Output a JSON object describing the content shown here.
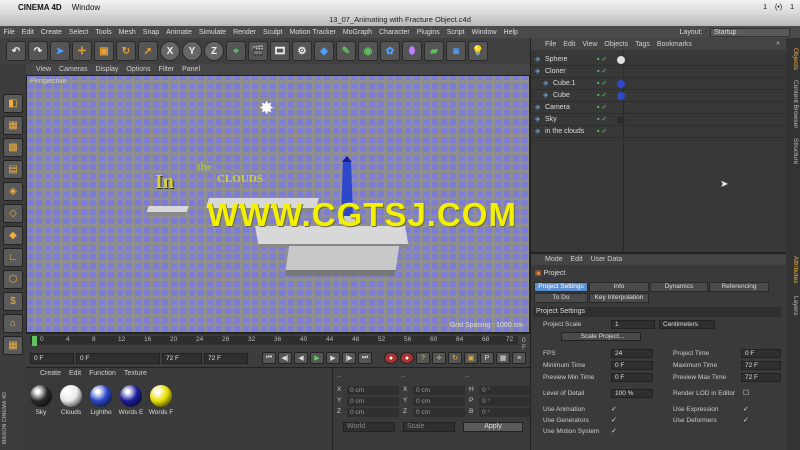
{
  "mac_menubar": {
    "app_name": "CINEMA 4D",
    "menu": "Window",
    "status": [
      "1",
      "(•)",
      "1"
    ]
  },
  "window_title": "13_07_Animating with Fracture Object.c4d",
  "app_menu": [
    "File",
    "Edit",
    "Create",
    "Select",
    "Tools",
    "Mesh",
    "Snap",
    "Animate",
    "Simulate",
    "Render",
    "Sculpt",
    "Motion Tracker",
    "MoGraph",
    "Character",
    "Plugins",
    "Script",
    "Window",
    "Help"
  ],
  "layout": {
    "label": "Layout:",
    "value": "Startup"
  },
  "viewport": {
    "menu": [
      "View",
      "Cameras",
      "Display",
      "Options",
      "Filter",
      "Panel"
    ],
    "label": "Perspective",
    "grid_spacing": "Grid Spacing : 1000 cm",
    "scene_text_1": "In",
    "scene_text_2": "the",
    "scene_text_3": "CLOUDS",
    "watermark": "WWW.CGTSJ.COM"
  },
  "timeline": {
    "ticks": [
      "0",
      "4",
      "8",
      "12",
      "16",
      "20",
      "24",
      "28",
      "32",
      "36",
      "40",
      "44",
      "48",
      "52",
      "56",
      "60",
      "64",
      "68",
      "72"
    ],
    "current": "0 F"
  },
  "transport": {
    "start": "0 F",
    "current": "0 F",
    "end": "72 F",
    "max": "72 F"
  },
  "materials": {
    "menu": [
      "Create",
      "Edit",
      "Function",
      "Texture"
    ],
    "items": [
      {
        "name": "Sky",
        "color": "#2a2a2a"
      },
      {
        "name": "Clouds",
        "color": "#e8e8e8"
      },
      {
        "name": "Lightho",
        "color": "#2c48c8"
      },
      {
        "name": "Words E",
        "color": "#1c1c9a"
      },
      {
        "name": "Words F",
        "color": "#e8e000"
      }
    ]
  },
  "coords": {
    "rows": [
      {
        "a": "X",
        "av": "0 cm",
        "b": "X",
        "bv": "0 cm",
        "c": "H",
        "cv": "0 °"
      },
      {
        "a": "Y",
        "av": "0 cm",
        "b": "Y",
        "bv": "0 cm",
        "c": "P",
        "cv": "0 °"
      },
      {
        "a": "Z",
        "av": "0 cm",
        "b": "Z",
        "bv": "0 cm",
        "c": "B",
        "cv": "0 °"
      }
    ],
    "mode1": "World",
    "mode2": "Scale",
    "apply": "Apply"
  },
  "objects": {
    "menu": [
      "File",
      "Edit",
      "View",
      "Objects",
      "Tags",
      "Bookmarks"
    ],
    "items": [
      {
        "name": "Sphere",
        "indent": 0,
        "tag": "#e0e0e0"
      },
      {
        "name": "Cloner",
        "indent": 0,
        "tag": ""
      },
      {
        "name": "Cube.1",
        "indent": 1,
        "tag": "#2c48c8"
      },
      {
        "name": "Cube",
        "indent": 1,
        "tag": "#2c48c8"
      },
      {
        "name": "Camera",
        "indent": 0,
        "tag": ""
      },
      {
        "name": "Sky",
        "indent": 0,
        "tag": "#2a2a2a"
      },
      {
        "name": "in the clouds",
        "indent": 0,
        "tag": ""
      }
    ]
  },
  "attributes": {
    "menu": [
      "Mode",
      "Edit",
      "User Data"
    ],
    "title": "Project",
    "tabs": [
      "Project Settings",
      "Info",
      "Dynamics",
      "Referencing",
      "To Do",
      "Key Interpolation"
    ],
    "section": "Project Settings",
    "project_scale_label": "Project Scale",
    "project_scale_value": "1",
    "project_scale_unit": "Centimeters",
    "scale_button": "Scale Project...",
    "left_fields": [
      {
        "label": "FPS",
        "value": "24"
      },
      {
        "label": "Minimum Time",
        "value": "0 F"
      },
      {
        "label": "Preview Min Time",
        "value": "0 F"
      },
      {
        "label": "Level of Detail",
        "value": "100 %"
      }
    ],
    "right_fields": [
      {
        "label": "Project Time",
        "value": "0 F"
      },
      {
        "label": "Maximum Time",
        "value": "72 F"
      },
      {
        "label": "Preview Max Time",
        "value": "72 F"
      },
      {
        "label": "Render LOD in Editor",
        "value": ""
      }
    ],
    "checks_left": [
      "Use Animation",
      "Use Generators",
      "Use Motion System"
    ],
    "checks_right": [
      "Use Expression",
      "Use Deformers"
    ]
  },
  "side_tabs": [
    "Objects",
    "Content Browser",
    "Structure",
    "Attributes",
    "Layers"
  ],
  "brand": "MAXON CINEMA 4D"
}
